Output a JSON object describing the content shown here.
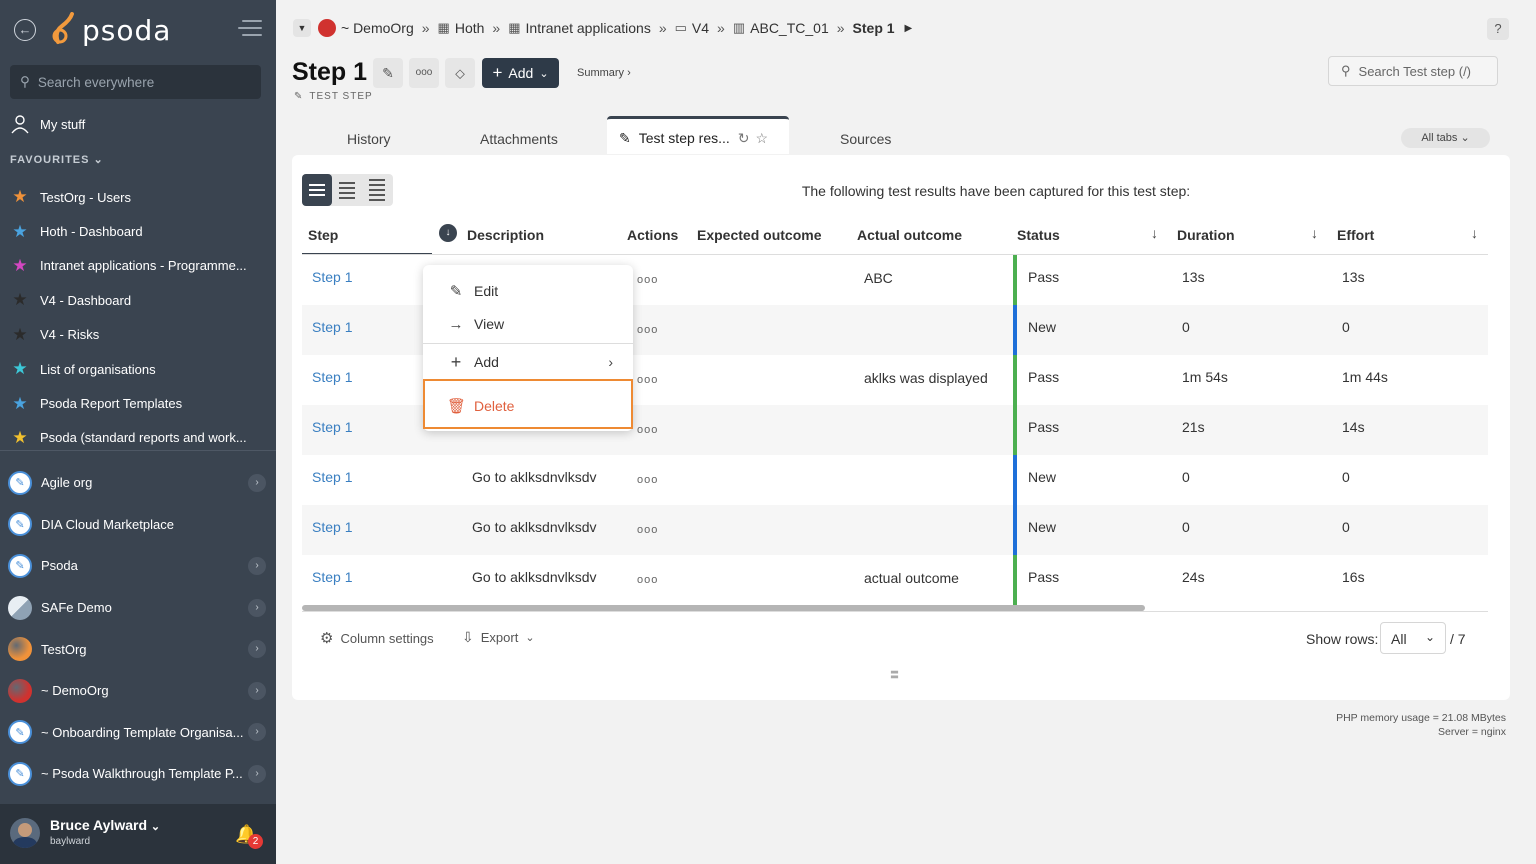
{
  "sidebar": {
    "logo": "psoda",
    "search_placeholder": "Search everywhere",
    "my_stuff": "My stuff",
    "favourites_heading": "FAVOURITES",
    "favourites": [
      {
        "label": "TestOrg - Users",
        "color": "#f0923a"
      },
      {
        "label": "Hoth - Dashboard",
        "color": "#4aa3df"
      },
      {
        "label": "Intranet applications - Programme...",
        "color": "#d447c2"
      },
      {
        "label": "V4 - Dashboard",
        "color": "#2b2b2b"
      },
      {
        "label": "V4 - Risks",
        "color": "#2b2b2b"
      },
      {
        "label": "List of organisations",
        "color": "#3cc8d8"
      },
      {
        "label": "Psoda Report Templates",
        "color": "#4aa3df"
      },
      {
        "label": "Psoda (standard reports and work...",
        "color": "#f2c12e"
      }
    ],
    "orgs": [
      {
        "label": "Agile org",
        "icon": "pen-icon",
        "color": "#4a90d9",
        "arrow": true
      },
      {
        "label": "DIA Cloud Marketplace",
        "icon": "pen-icon",
        "color": "#4a90d9",
        "arrow": false
      },
      {
        "label": "Psoda",
        "icon": "pen-icon",
        "color": "#4a90d9",
        "arrow": true
      },
      {
        "label": "SAFe Demo",
        "icon": "safe-icon",
        "color": "#b8c4cf",
        "arrow": true
      },
      {
        "label": "TestOrg",
        "icon": "orange-globe-icon",
        "color": "#f0923a",
        "arrow": true
      },
      {
        "label": "~ DemoOrg",
        "icon": "red-globe-icon",
        "color": "#d0322f",
        "arrow": true
      },
      {
        "label": "~ Onboarding Template Organisa...",
        "icon": "pen-icon",
        "color": "#4a90d9",
        "arrow": true
      },
      {
        "label": "~ Psoda Walkthrough Template P...",
        "icon": "pen-icon",
        "color": "#4a90d9",
        "arrow": true
      }
    ],
    "user": {
      "name": "Bruce Aylward",
      "login": "baylward",
      "notifications": "2"
    }
  },
  "breadcrumb": {
    "items": [
      "~ DemoOrg",
      "Hoth",
      "Intranet applications",
      "V4",
      "ABC_TC_01"
    ],
    "current": "Step 1"
  },
  "header": {
    "title": "Step 1",
    "add_label": "Add",
    "summary": "Summary ›",
    "type": "TEST STEP",
    "search_placeholder": "Search Test step (/)",
    "help": "?"
  },
  "tabs": {
    "items": [
      "History",
      "Attachments",
      "Test step res...",
      "Sources"
    ],
    "all_tabs": "All tabs"
  },
  "content": {
    "intro": "The following test results have been captured for this test step:"
  },
  "table": {
    "columns": [
      "Step",
      "Description",
      "Actions",
      "Expected outcome",
      "Actual outcome",
      "Status",
      "Duration",
      "Effort"
    ],
    "rows": [
      {
        "step": "Step 1",
        "description": "",
        "actions": "ooo",
        "expected": "",
        "actual": "ABC",
        "status": "Pass",
        "status_color": "#4caf50",
        "duration": "13s",
        "effort": "13s"
      },
      {
        "step": "Step 1",
        "description": "",
        "actions": "ooo",
        "expected": "",
        "actual": "",
        "status": "New",
        "status_color": "#1e6fd9",
        "duration": "0",
        "effort": "0"
      },
      {
        "step": "Step 1",
        "description": "",
        "actions": "ooo",
        "expected": "",
        "actual": "aklks was displayed",
        "status": "Pass",
        "status_color": "#4caf50",
        "duration": "1m 54s",
        "effort": "1m 44s"
      },
      {
        "step": "Step 1",
        "description": "",
        "actions": "ooo",
        "expected": "",
        "actual": "",
        "status": "Pass",
        "status_color": "#4caf50",
        "duration": "21s",
        "effort": "14s"
      },
      {
        "step": "Step 1",
        "description": "Go to aklksdnvlksdv",
        "actions": "ooo",
        "expected": "",
        "actual": "",
        "status": "New",
        "status_color": "#1e6fd9",
        "duration": "0",
        "effort": "0"
      },
      {
        "step": "Step 1",
        "description": "Go to aklksdnvlksdv",
        "actions": "ooo",
        "expected": "",
        "actual": "",
        "status": "New",
        "status_color": "#1e6fd9",
        "duration": "0",
        "effort": "0"
      },
      {
        "step": "Step 1",
        "description": "Go to aklksdnvlksdv",
        "actions": "ooo",
        "expected": "",
        "actual": "actual outcome",
        "status": "Pass",
        "status_color": "#4caf50",
        "duration": "24s",
        "effort": "16s"
      }
    ]
  },
  "footer": {
    "column_settings": "Column settings",
    "export": "Export",
    "show_rows_label": "Show rows:",
    "show_rows_value": "All",
    "total": "/ 7"
  },
  "context_menu": {
    "edit": "Edit",
    "view": "View",
    "add": "Add",
    "delete": "Delete"
  },
  "server_info": {
    "memory": "PHP memory usage = 21.08 MBytes",
    "server": "Server = nginx"
  }
}
